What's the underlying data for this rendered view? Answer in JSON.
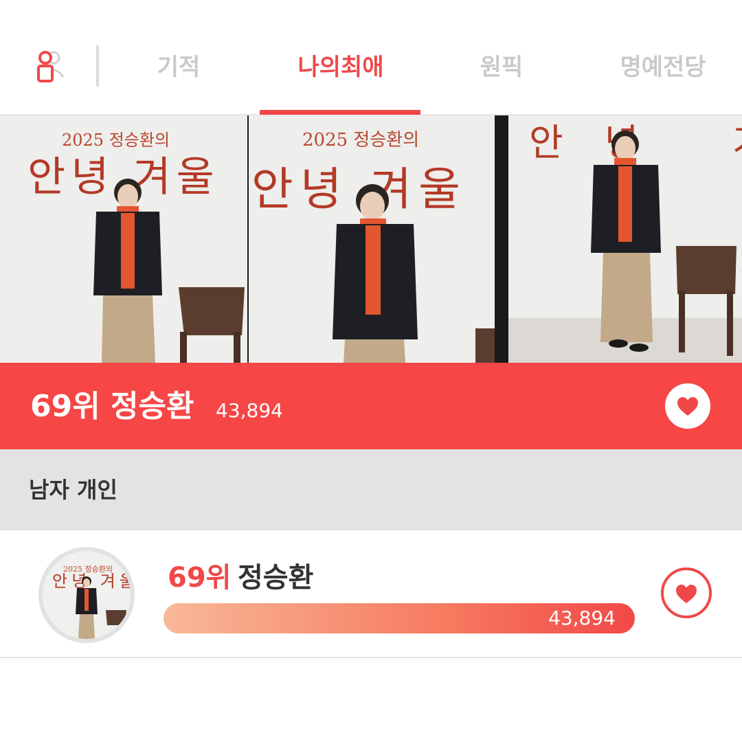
{
  "header": {
    "tabs": [
      {
        "label": "기적",
        "active": false
      },
      {
        "label": "나의최애",
        "active": true
      },
      {
        "label": "원픽",
        "active": false
      },
      {
        "label": "명예전당",
        "active": false
      }
    ]
  },
  "banner": {
    "poster_year_title": "2025 정승환의",
    "poster_main_title": "안녕 겨울"
  },
  "featured": {
    "rank_name": "69위 정승환",
    "count": "43,894"
  },
  "section": {
    "title": "남자 개인"
  },
  "list": [
    {
      "rank": "69위",
      "name": "정승환",
      "count": "43,894",
      "progress": 1.0
    }
  ],
  "colors": {
    "accent": "#f04848",
    "rank_bar": "#f64646",
    "tab_inactive": "#c9c9c9",
    "section_bg": "#e3e3e3"
  },
  "icons": [
    "user-icon",
    "heart-icon",
    "heart-outline-icon"
  ]
}
